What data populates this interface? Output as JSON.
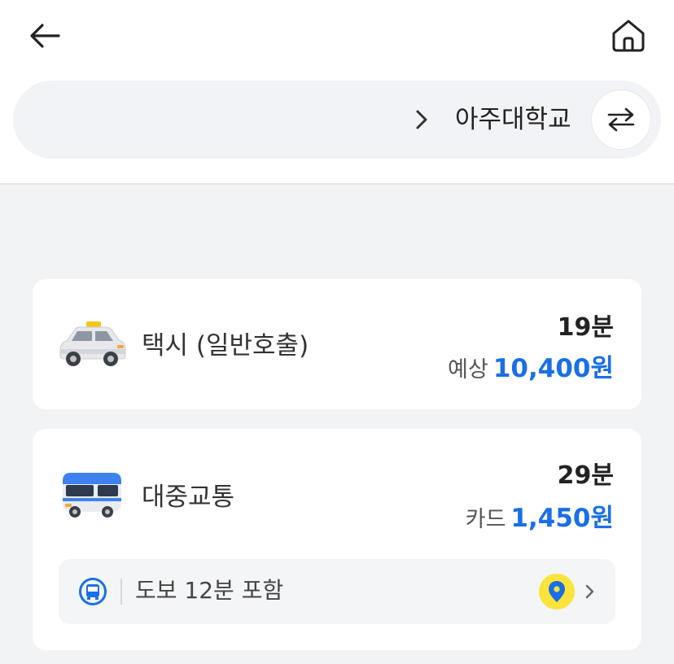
{
  "header": {
    "back_icon": "arrow-left-icon",
    "home_icon": "home-icon"
  },
  "route": {
    "origin_value": "",
    "destination": "아주대학교",
    "swap_icon": "swap-arrows-icon"
  },
  "options": [
    {
      "mode": "택시 (일반호출)",
      "icon": "taxi-icon",
      "time": "19분",
      "price_label": "예상",
      "price": "10,400원"
    },
    {
      "mode": "대중교통",
      "icon": "bus-icon",
      "time": "29분",
      "price_label": "카드",
      "price": "1,450원",
      "detail": {
        "text": "도보 12분 포함",
        "transit_icon": "bus-badge-icon",
        "map_icon": "location-pin-icon"
      }
    }
  ],
  "colors": {
    "accent_price": "#1a6fe8",
    "pin_bg": "#fde33a",
    "background": "#f2f3f5"
  }
}
